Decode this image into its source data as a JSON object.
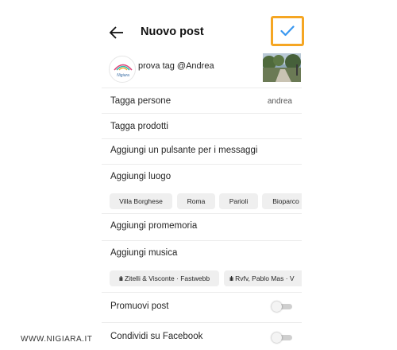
{
  "header": {
    "title": "Nuovo post",
    "back_icon": "arrow-left-icon",
    "confirm_icon": "checkmark-icon",
    "accent_color": "#3897f0",
    "highlight_color": "#f5a623"
  },
  "post": {
    "avatar_text": "Nigiara",
    "caption": "prova tag @Andrea"
  },
  "rows": {
    "tag_people": {
      "label": "Tagga persone",
      "value": "andrea"
    },
    "tag_products": {
      "label": "Tagga prodotti"
    },
    "add_message_button": {
      "label": "Aggiungi un pulsante per i messaggi"
    },
    "add_location": {
      "label": "Aggiungi luogo"
    },
    "add_reminder": {
      "label": "Aggiungi promemoria"
    },
    "add_music": {
      "label": "Aggiungi musica"
    },
    "promote_post": {
      "label": "Promuovi post",
      "toggle_on": false
    },
    "share_facebook": {
      "label": "Condividi su Facebook",
      "toggle_on": false
    }
  },
  "location_chips": [
    "Villa Borghese",
    "Roma",
    "Parioli",
    "Bioparco"
  ],
  "music_chips": [
    "Zitelli & Visconte · Fastwebb",
    "Rvfv, Pablo Mas · V"
  ],
  "watermark": "WWW.NIGIARA.IT"
}
